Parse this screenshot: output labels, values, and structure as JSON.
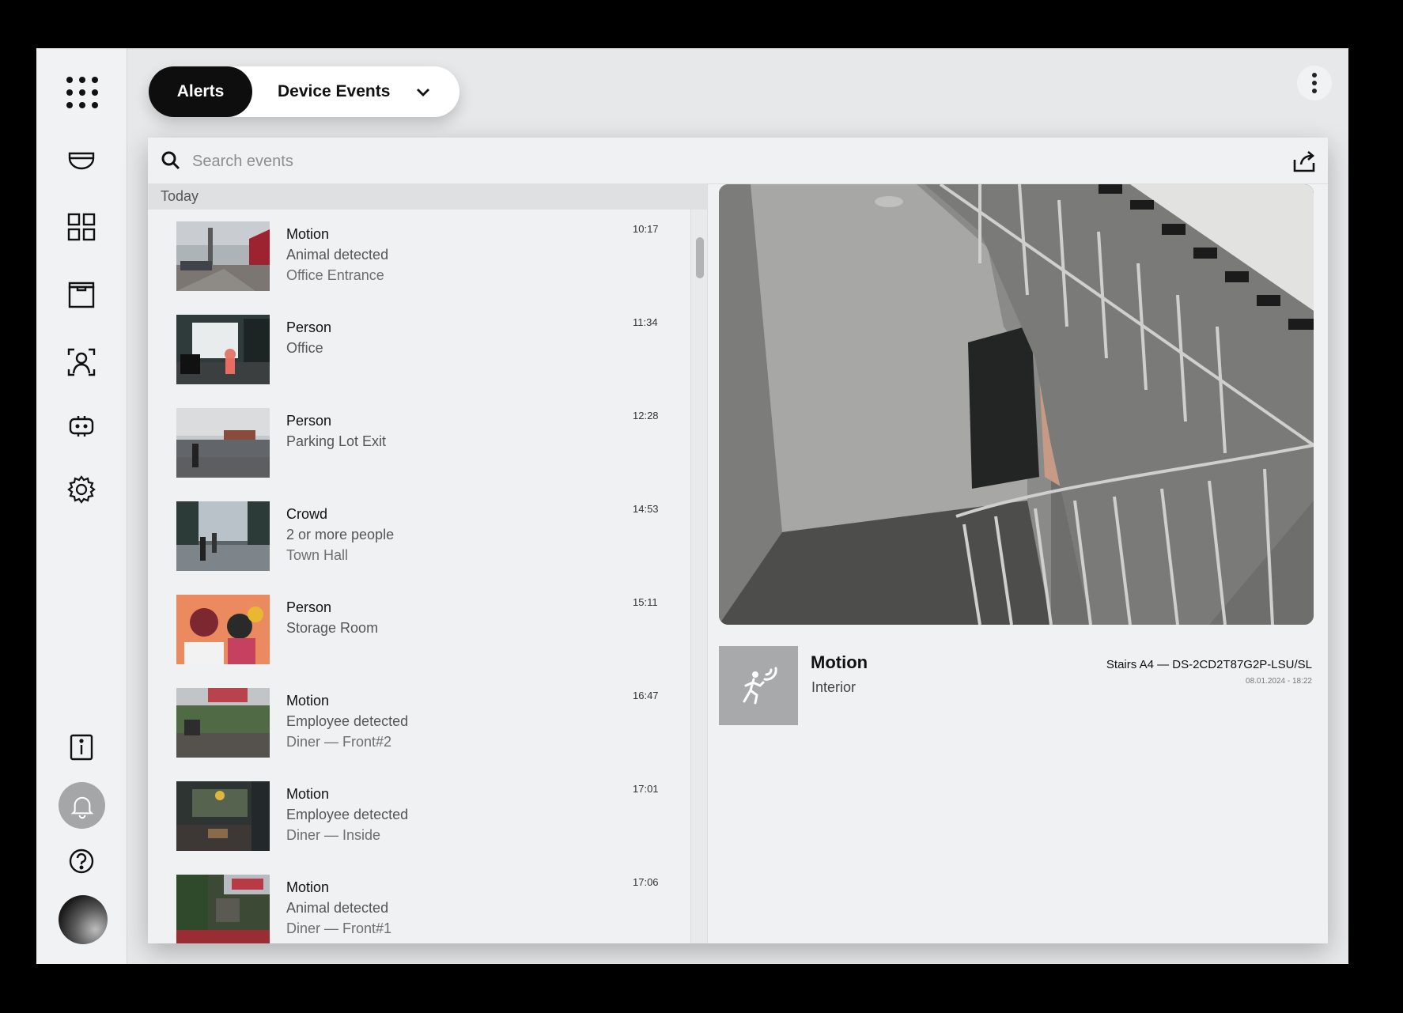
{
  "header": {
    "tabs": [
      {
        "label": "Alerts",
        "active": true
      },
      {
        "label": "Device Events",
        "active": false
      }
    ],
    "more_menu_icon": "kebab-vertical-icon"
  },
  "sidebar": {
    "items": [
      {
        "icon": "apps-grid-icon"
      },
      {
        "icon": "dome-camera-icon"
      },
      {
        "icon": "dashboard-grid-icon"
      },
      {
        "icon": "archive-box-icon"
      },
      {
        "icon": "face-recognition-icon"
      },
      {
        "icon": "device-icon"
      },
      {
        "icon": "settings-gear-icon"
      }
    ],
    "bottom_items": [
      {
        "icon": "info-icon"
      },
      {
        "icon": "bell-icon",
        "active": true
      },
      {
        "icon": "help-icon"
      },
      {
        "icon": "user-avatar"
      }
    ]
  },
  "search": {
    "placeholder": "Search events",
    "value": "",
    "export_icon": "share-export-icon"
  },
  "events": {
    "section_label": "Today",
    "items": [
      {
        "type": "Motion",
        "line2": "Animal detected",
        "line3": "Office Entrance",
        "time": "10:17"
      },
      {
        "type": "Person",
        "line2": "Office",
        "line3": "",
        "time": "11:34"
      },
      {
        "type": "Person",
        "line2": "Parking Lot Exit",
        "line3": "",
        "time": "12:28"
      },
      {
        "type": "Crowd",
        "line2": "2 or more people",
        "line3": "Town Hall",
        "time": "14:53"
      },
      {
        "type": "Person",
        "line2": "Storage Room",
        "line3": "",
        "time": "15:11"
      },
      {
        "type": "Motion",
        "line2": "Employee detected",
        "line3": "Diner — Front#2",
        "time": "16:47"
      },
      {
        "type": "Motion",
        "line2": "Employee detected",
        "line3": "Diner — Inside",
        "time": "17:01"
      },
      {
        "type": "Motion",
        "line2": "Animal detected",
        "line3": "Diner — Front#1",
        "time": "17:06"
      }
    ]
  },
  "detail": {
    "title": "Motion",
    "subtitle": "Interior",
    "device": "Stairs A4 — DS-2CD2T87G2P-LSU/SL",
    "datetime": "08.01.2024 - 18:22",
    "icon": "motion-person-icon"
  },
  "colors": {
    "active_tab_bg": "#0e0e0e",
    "active_nav_bg": "#a5a6a8",
    "panel_bg": "#f0f1f2"
  }
}
